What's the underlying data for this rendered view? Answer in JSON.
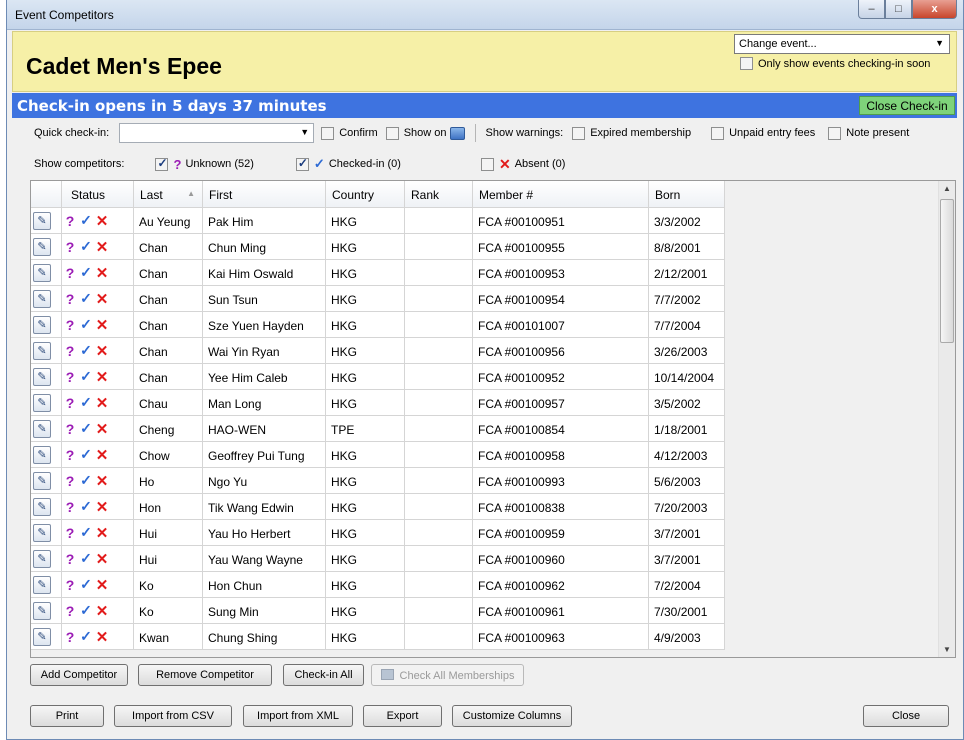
{
  "window": {
    "title": "Event Competitors",
    "minimize": "–",
    "maximize": "□",
    "close": "x"
  },
  "header": {
    "event_title": "Cadet Men's Epee",
    "change_event": "Change event...",
    "only_show_soon": "Only show events checking-in soon",
    "only_show_soon_checked": false
  },
  "banner": {
    "text": "Check-in opens in 5 days 37 minutes",
    "close_checkin": "Close Check-in",
    "color": "#3e73e0",
    "close_color": "#7ed37a"
  },
  "quick_checkin": {
    "label": "Quick check-in:",
    "value": "",
    "confirm": "Confirm",
    "show_on": "Show on",
    "show_warnings": "Show warnings:",
    "expired": "Expired membership",
    "unpaid": "Unpaid entry fees",
    "note": "Note present"
  },
  "filters": {
    "label": "Show competitors:",
    "unknown": "Unknown (52)",
    "checked_in": "Checked-in (0)",
    "absent": "Absent (0)"
  },
  "columns": [
    "Status",
    "Last",
    "First",
    "Country",
    "Rank",
    "Member #",
    "Born"
  ],
  "rows": [
    [
      "Au Yeung",
      "Pak Him",
      "HKG",
      "",
      "FCA #00100951",
      "3/3/2002"
    ],
    [
      "Chan",
      "Chun Ming",
      "HKG",
      "",
      "FCA #00100955",
      "8/8/2001"
    ],
    [
      "Chan",
      "Kai Him Oswald",
      "HKG",
      "",
      "FCA #00100953",
      "2/12/2001"
    ],
    [
      "Chan",
      "Sun Tsun",
      "HKG",
      "",
      "FCA #00100954",
      "7/7/2002"
    ],
    [
      "Chan",
      "Sze Yuen Hayden",
      "HKG",
      "",
      "FCA #00101007",
      "7/7/2004"
    ],
    [
      "Chan",
      "Wai Yin Ryan",
      "HKG",
      "",
      "FCA #00100956",
      "3/26/2003"
    ],
    [
      "Chan",
      "Yee Him Caleb",
      "HKG",
      "",
      "FCA #00100952",
      "10/14/2004"
    ],
    [
      "Chau",
      "Man Long",
      "HKG",
      "",
      "FCA #00100957",
      "3/5/2002"
    ],
    [
      "Cheng",
      "HAO-WEN",
      "TPE",
      "",
      "FCA #00100854",
      "1/18/2001"
    ],
    [
      "Chow",
      "Geoffrey Pui Tung",
      "HKG",
      "",
      "FCA #00100958",
      "4/12/2003"
    ],
    [
      "Ho",
      "Ngo Yu",
      "HKG",
      "",
      "FCA #00100993",
      "5/6/2003"
    ],
    [
      "Hon",
      "Tik Wang Edwin",
      "HKG",
      "",
      "FCA #00100838",
      "7/20/2003"
    ],
    [
      "Hui",
      "Yau Ho Herbert",
      "HKG",
      "",
      "FCA #00100959",
      "3/7/2001"
    ],
    [
      "Hui",
      "Yau Wang Wayne",
      "HKG",
      "",
      "FCA #00100960",
      "3/7/2001"
    ],
    [
      "Ko",
      "Hon Chun",
      "HKG",
      "",
      "FCA #00100962",
      "7/2/2004"
    ],
    [
      "Ko",
      "Sung Min",
      "HKG",
      "",
      "FCA #00100961",
      "7/30/2001"
    ],
    [
      "Kwan",
      "Chung Shing",
      "HKG",
      "",
      "FCA #00100963",
      "4/9/2003"
    ]
  ],
  "buttons": {
    "add": "Add Competitor",
    "remove": "Remove Competitor",
    "checkin_all": "Check-in All",
    "check_memberships": "Check All Memberships",
    "print": "Print",
    "import_csv": "Import from CSV",
    "import_xml": "Import from XML",
    "export": "Export",
    "customize": "Customize Columns",
    "close": "Close"
  },
  "icons": {
    "edit": "✎",
    "unknown": "?",
    "checked": "✓",
    "absent": "✕",
    "dropdown": "▼",
    "sort": "▲",
    "scroll_up": "▲",
    "scroll_down": "▼"
  }
}
